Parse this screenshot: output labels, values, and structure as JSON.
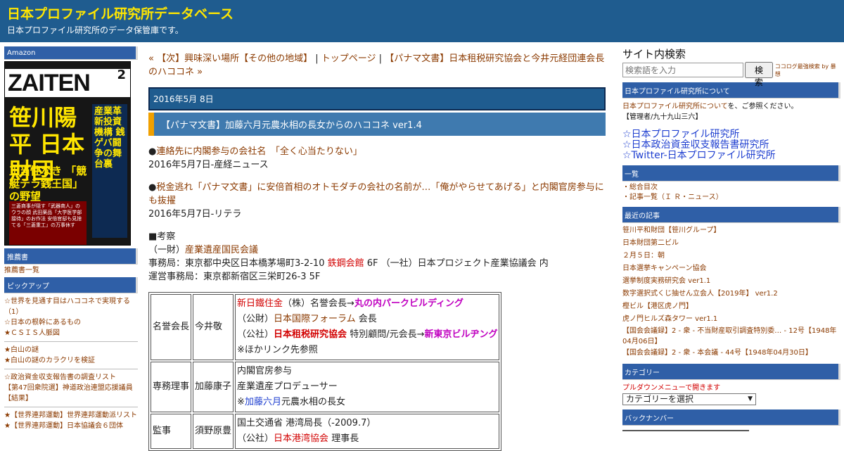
{
  "header": {
    "title": "日本プロファイル研究所データベース",
    "description": "日本プロファイル研究所のデータ保管庫です。"
  },
  "left": {
    "amazon_heading": "Amazon",
    "book": {
      "mast": "ZAITEN",
      "issue": "2",
      "headline": "笹川陽平 日本財団",
      "sub": "正当性なき 「競艇テラ銭王国」 の野望",
      "vertical": "産業革新投資機構 銭ゲバ闘争の舞台裏",
      "inset": "三菱商事が隠す「武器商人」のウラの顔 武田薬品「大学医学部接待」のお作法 安倍官邸も見捨てる「三菱重工」の万事休す"
    },
    "recommended_heading": "推薦書",
    "recommended_link": "推薦書一覧",
    "pickup_heading": "ピックアップ",
    "pickup_items": [
      "☆世界を見通す目はハココネで実現する（1）",
      "☆日本の根幹にあるもの",
      "★ＣＳＩＳ人脈図",
      "★白山の謎",
      "★白山の謎のカラクリを検証",
      "☆政治資金収支報告書の調査リスト",
      "【第47回衆院選】神道政治連盟応援議員【結果】",
      "★【世界連邦運動】世界連邦運動派リスト",
      "★【世界連邦運動】日本協議会６団体"
    ]
  },
  "main": {
    "nav": {
      "prev": "« 【次】興味深い場所【その他の地域】",
      "sep1": "|",
      "top": "トップページ",
      "sep2": "|",
      "next": "【パナマ文書】日本租税研究協会と今井元経団連会長のハココネ »"
    },
    "date": "2016年5月 8日",
    "title": "【パナマ文書】加藤六月元農水相の長女からのハココネ ver1.4",
    "items": [
      {
        "bullet": "●",
        "link": "連絡先に内閣参与の会社名　「全く心当たりない」",
        "source": "2016年5月7日-産経ニュース"
      },
      {
        "bullet": "●",
        "link": "税金逃れ「パナマ文書」に安倍首相のオトモダチの会社の名前が…「俺がやらせてあげる」と内閣官房参与にも抜擢",
        "source": "2016年5月7日-リテラ"
      }
    ],
    "consider": {
      "head": "■考察",
      "line1_prefix": "（一財）",
      "line1_link": "産業遺産国民会議",
      "line2_a": "事務局：東京都中央区日本橋茅場町3-2-10 ",
      "line2_b": "鉄鋼会館",
      "line2_c": " 6F （一社）日本プロジェクト産業協議会 内",
      "line3": "運営事務局：東京都新宿区三栄町26-3 5F"
    },
    "table": [
      {
        "role": "名誉会長",
        "name": "今井敬",
        "lines": [
          {
            "a": "新日鐵住金",
            "b": "（株）名誉会長→",
            "c": "丸の内パークビルディング"
          },
          {
            "a": "（公財）",
            "b": "日本国際フォーラム",
            "c": " 会長"
          },
          {
            "a": "（公社）",
            "b": "日本租税研究協会",
            "c": " 特別顧問/元会長→",
            "d": "新東京ビルヂング"
          },
          {
            "a": "※ほかリンク先参照"
          }
        ]
      },
      {
        "role": "専務理事",
        "name": "加藤康子",
        "lines": [
          {
            "a": "内閣官房参与"
          },
          {
            "a": "産業遺産プロデューサー"
          },
          {
            "a": "※",
            "b": "加藤六月",
            "c": "元農水相の長女"
          }
        ]
      },
      {
        "role": "監事",
        "name": "須野原豊",
        "lines": [
          {
            "a": "国土交通省 港湾局長（-2009.7）"
          },
          {
            "a": "（公社）",
            "b": "日本港湾協会",
            "c": " 理事長"
          }
        ]
      }
    ]
  },
  "right": {
    "search_title": "サイト内検索",
    "search_placeholder": "検索語を入力",
    "search_button": "検索",
    "search_credit": "ココログ最強検索 by 暴想",
    "about_heading": "日本プロファイル研究所について",
    "about_link": "日本プロファイル研究所について",
    "about_suffix": "を、ご参照ください。",
    "admin": "【管理者/九十九山三六】",
    "big_links": [
      "☆日本プロファイル研究所",
      "☆日本政治資金収支報告書研究所",
      "☆Twitter-日本プロファイル研究所"
    ],
    "list_heading": "一覧",
    "list_items": [
      "・総合目次",
      "・記事一覧（Ｉ Ｒ・ニュース）"
    ],
    "recent_heading": "最近の記事",
    "recent_items": [
      "笹川平和財団【笹川グループ】",
      "日本財団第二ビル",
      "２月５日：朝",
      "日本選挙キャンペーン協会",
      "選挙制度実務研究会 ver1.1",
      "数字選択式くじ抽せん立会人【2019年】 ver1.2",
      "樫ビル【港区虎ノ門】",
      "虎ノ門ヒルズ森タワー ver1.1",
      "【国会会議録】2 - 衆 - 不当財産取引調査特別委… - 12号【1948年04月06日】",
      "【国会会議録】2 - 衆 - 本会議 - 44号【1948年04月30日】"
    ],
    "category_heading": "カテゴリー",
    "category_note": "プルダウンメニューで開きます",
    "category_select": "カテゴリーを選択",
    "backnumber_heading": "バックナンバー"
  }
}
